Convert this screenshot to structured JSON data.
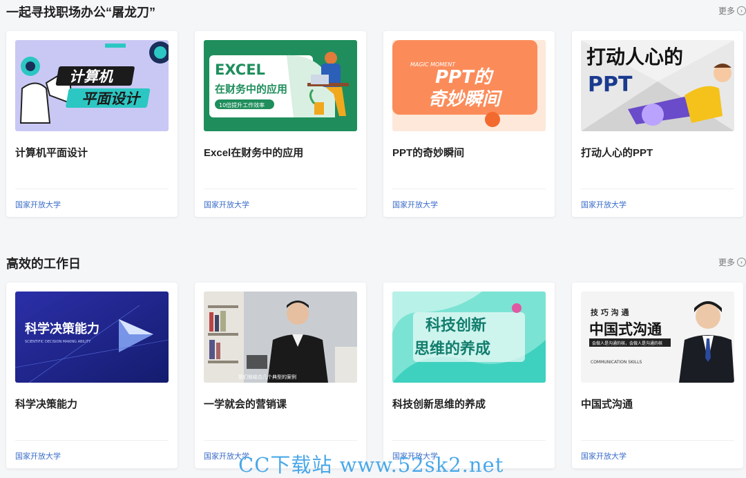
{
  "sections": [
    {
      "title": "一起寻找职场办公“屠龙刀”",
      "more_label": "更多",
      "cards": [
        {
          "title": "计算机平面设计",
          "provider": "国家开放大学",
          "thumb_text": [
            "计算机",
            "平面设计"
          ]
        },
        {
          "title": "Excel在财务中的应用",
          "provider": "国家开放大学",
          "thumb_text": [
            "EXCEL",
            "在财务中的应用",
            "10倍提升工作效率"
          ]
        },
        {
          "title": "PPT的奇妙瞬间",
          "provider": "国家开放大学",
          "thumb_text": [
            "MAGIC MOMENT",
            "PPT的",
            "奇妙瞬间"
          ]
        },
        {
          "title": "打动人心的PPT",
          "provider": "国家开放大学",
          "thumb_text": [
            "打动人心的",
            "PPT"
          ]
        }
      ]
    },
    {
      "title": "高效的工作日",
      "more_label": "更多",
      "cards": [
        {
          "title": "科学决策能力",
          "provider": "国家开放大学",
          "thumb_text": [
            "科学决策能力",
            "SCIENTIFIC DECISION MAKING ABILITY"
          ]
        },
        {
          "title": "一学就会的营销课",
          "provider": "国家开放大学",
          "thumb_text": [
            "我们就结合几个典型的案例"
          ]
        },
        {
          "title": "科技创新思维的养成",
          "provider": "国家开放大学",
          "thumb_text": [
            "科技创新",
            "思维的养成"
          ]
        },
        {
          "title": "中国式沟通",
          "provider": "国家开放大学",
          "thumb_text": [
            "技 巧 沟 通",
            "中国式沟通",
            "会做人是沟通的核，会做人是沟通的核",
            "COMMUNICATION SKILLS"
          ]
        }
      ]
    }
  ],
  "watermark": "CC下载站 www.52sk2.net",
  "icons": {
    "more": "chevron-right-circle-icon"
  },
  "colors": {
    "provider_link": "#3a6cc9",
    "watermark": "#4aa8e8"
  }
}
